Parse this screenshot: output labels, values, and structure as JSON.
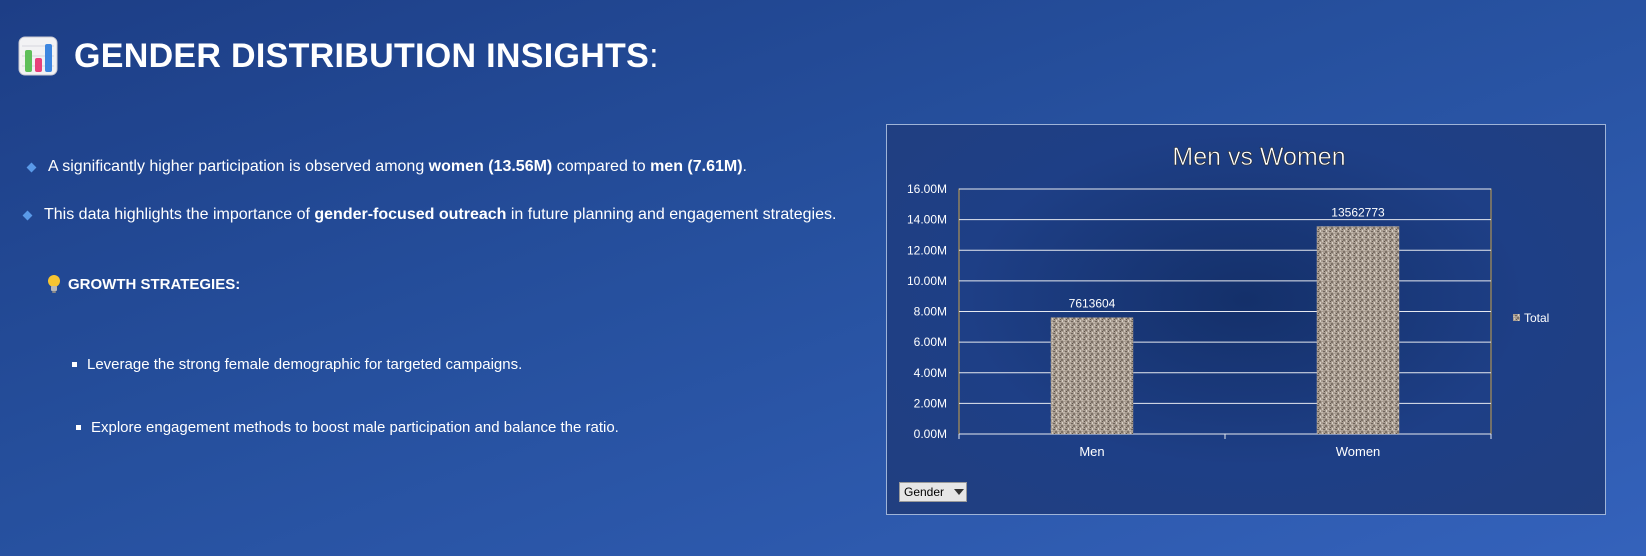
{
  "header": {
    "title": "GENDER DISTRIBUTION INSIGHTS",
    "colon": ":"
  },
  "bullets": [
    {
      "pre": "A significantly higher participation is observed among ",
      "b1": "women (13.56M)",
      "mid": " compared to ",
      "b2": "men (7.61M)",
      "post": "."
    },
    {
      "pre": "This data highlights the importance of ",
      "b1": "gender-focused outreach",
      "post": " in future planning and engagement strategies."
    }
  ],
  "growth": {
    "heading": "GROWTH STRATEGIES:"
  },
  "strategies": [
    "Leverage the strong female demographic for targeted campaigns.",
    "Explore engagement methods to boost male participation and balance the ratio."
  ],
  "field_button": {
    "label": "Gender"
  },
  "colors": {
    "accent": "#5a9ae8",
    "bar": "#a89c90",
    "plot_border": "#c8a24a"
  },
  "chart_data": {
    "type": "bar",
    "title": "Men vs Women",
    "categories": [
      "Men",
      "Women"
    ],
    "series": [
      {
        "name": "Total",
        "values": [
          7613604,
          13562773
        ]
      }
    ],
    "data_labels": [
      "7613604",
      "13562773"
    ],
    "ylim": [
      0,
      16000000
    ],
    "yticks": [
      0,
      2000000,
      4000000,
      6000000,
      8000000,
      10000000,
      12000000,
      14000000,
      16000000
    ],
    "ytick_labels": [
      "0.00M",
      "2.00M",
      "4.00M",
      "6.00M",
      "8.00M",
      "10.00M",
      "12.00M",
      "14.00M",
      "16.00M"
    ],
    "grid": true,
    "legend": "right"
  }
}
